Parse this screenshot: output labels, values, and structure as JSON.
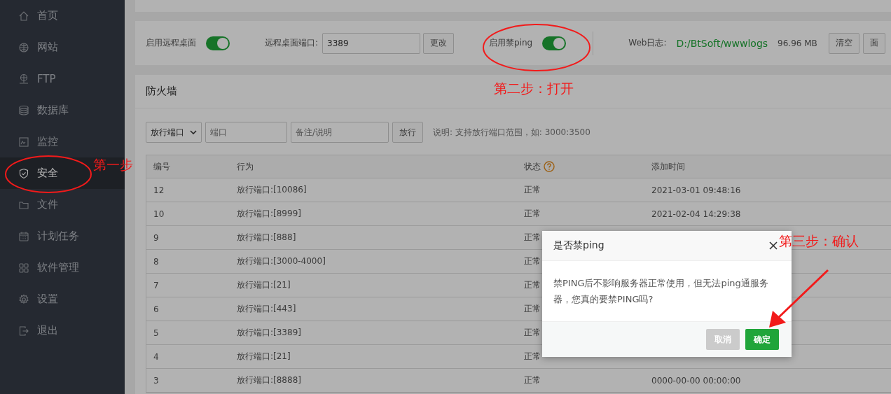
{
  "sidebar": {
    "items": [
      {
        "label": "首页",
        "selected": false
      },
      {
        "label": "网站",
        "selected": false
      },
      {
        "label": "FTP",
        "selected": false
      },
      {
        "label": "数据库",
        "selected": false
      },
      {
        "label": "监控",
        "selected": false
      },
      {
        "label": "安全",
        "selected": true
      },
      {
        "label": "文件",
        "selected": false
      },
      {
        "label": "计划任务",
        "selected": false
      },
      {
        "label": "软件管理",
        "selected": false
      },
      {
        "label": "设置",
        "selected": false
      },
      {
        "label": "退出",
        "selected": false
      }
    ]
  },
  "settings": {
    "remote_desktop": {
      "label": "启用远程桌面",
      "on": true
    },
    "port": {
      "label": "远程桌面端口:",
      "value": "3389",
      "button": "更改"
    },
    "ping": {
      "label": "启用禁ping",
      "on": true
    },
    "web_log": {
      "label": "Web日志:",
      "path": "D:/BtSoft/wwwlogs",
      "size": "96.96 MB",
      "buttons": [
        "清空",
        "面"
      ]
    }
  },
  "firewall": {
    "title": "防火墙",
    "select": "放行端口",
    "port_placeholder": "端口",
    "note_placeholder": "备注/说明",
    "button": "放行",
    "hint": "说明: 支持放行端口范围，如: 3000:3500",
    "columns": [
      "编号",
      "行为",
      "状态",
      "添加时间"
    ],
    "rows": [
      {
        "id": "12",
        "action": "放行端口:[10086]",
        "status": "正常",
        "time": "2021-03-01 09:48:16"
      },
      {
        "id": "10",
        "action": "放行端口:[8999]",
        "status": "正常",
        "time": "2021-02-04 14:29:38"
      },
      {
        "id": "9",
        "action": "放行端口:[888]",
        "status": "正常"
      },
      {
        "id": "8",
        "action": "放行端口:[3000-4000]",
        "status": "正常"
      },
      {
        "id": "7",
        "action": "放行端口:[21]",
        "status": "正常"
      },
      {
        "id": "6",
        "action": "放行端口:[443]",
        "status": "正常"
      },
      {
        "id": "5",
        "action": "放行端口:[3389]",
        "status": "正常"
      },
      {
        "id": "4",
        "action": "放行端口:[21]",
        "status": "正常"
      },
      {
        "id": "3",
        "action": "放行端口:[8888]",
        "status": "正常",
        "time": "0000-00-00 00:00:00"
      }
    ]
  },
  "dialog": {
    "title": "是否禁ping",
    "message": "禁PING后不影响服务器正常使用，但无法ping通服务器，您真的要禁PING吗?",
    "buttons": [
      {
        "label": "取消",
        "kind": "secondary"
      },
      {
        "label": "确定",
        "kind": "primary"
      }
    ]
  },
  "annotations": {
    "step1": "第一步",
    "step2": "第二步：打开",
    "step3": "第三步：确认"
  }
}
